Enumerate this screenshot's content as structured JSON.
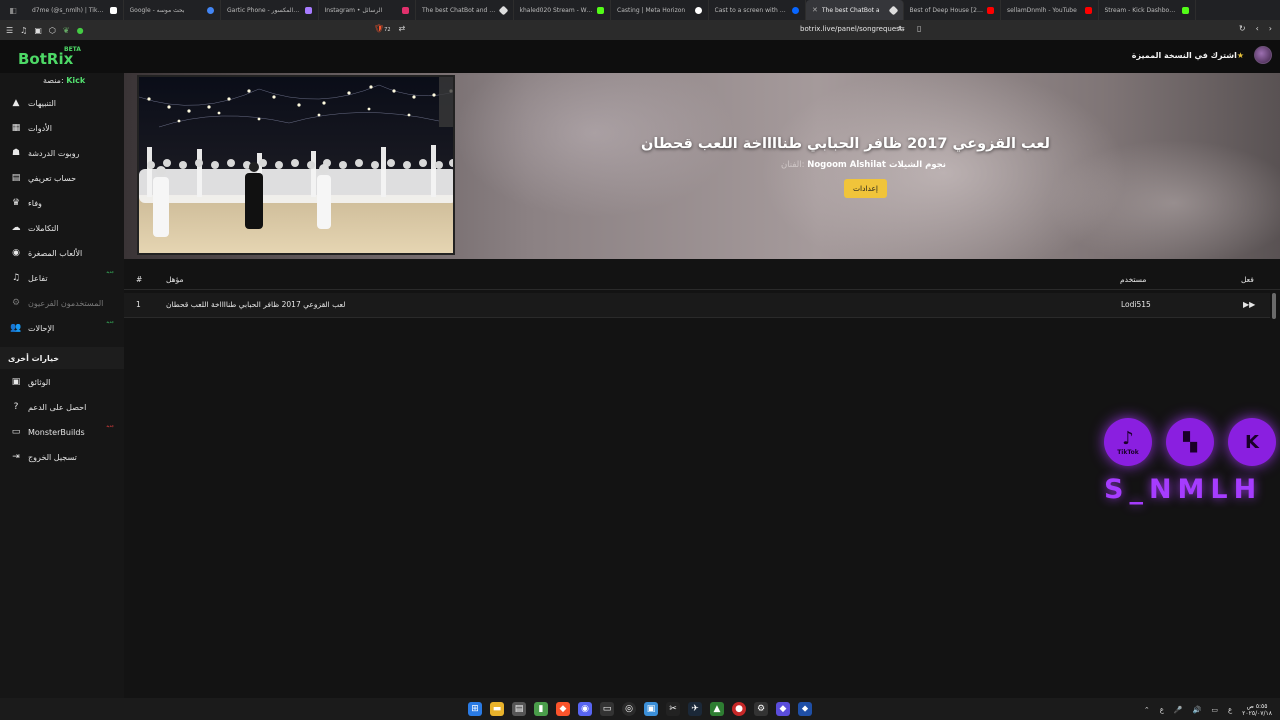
{
  "browser": {
    "tabs": [
      {
        "label": "d7me (@s_nmlh) | TikTok(5)",
        "color": "#ffffff"
      },
      {
        "label": "Google - بحث موسه",
        "color": "#4285f4"
      },
      {
        "label": "Gartic Phone - الطالب المكسور",
        "color": "#a77bff"
      },
      {
        "label": "Instagram • الرسائل",
        "color": "#e1306c"
      },
      {
        "label": "The best ChatBot and Wid",
        "color": "#ffffff"
      },
      {
        "label": "khaled020 Stream - Watch",
        "color": "#53fc18"
      },
      {
        "label": "Casting | Meta Horizon",
        "color": "#ffffff"
      },
      {
        "label": "Cast to a screen with Meta",
        "color": "#0866ff"
      },
      {
        "label": "The best ChatBot a",
        "color": "#ffffff",
        "active": true
      },
      {
        "label": "Best of Deep House [2025]",
        "color": "#ff0000"
      },
      {
        "label": "sellamDnmlh - YouTube",
        "color": "#ff0000"
      },
      {
        "label": "Stream - Kick Dashboard",
        "color": "#53fc18"
      }
    ],
    "url": "botrix.live/panel/songrequest",
    "shield_count": "72"
  },
  "app": {
    "logo": "BotRix",
    "logo_badge": "BETA",
    "premium_text": "اشترك في النسخة المميزة",
    "platform_label": "منصة:",
    "platform_value": "Kick"
  },
  "sidebar": {
    "items": [
      {
        "label": "التنبيهات",
        "icon": "warning-icon"
      },
      {
        "label": "الأدوات",
        "icon": "grid-icon"
      },
      {
        "label": "روبوت الدردشة",
        "icon": "robot-icon"
      },
      {
        "label": "حساب تعريفي",
        "icon": "id-card-icon"
      },
      {
        "label": "وفاء",
        "icon": "trophy-icon"
      },
      {
        "label": "التكاملات",
        "icon": "cloud-icon"
      },
      {
        "label": "الألعاب المصغرة",
        "icon": "gamepad-icon"
      },
      {
        "label": "تفاعل",
        "icon": "music-icon",
        "badge": "جديد"
      },
      {
        "label": "المستخدمون الفرعيون",
        "icon": "gear-icon",
        "disabled": true
      },
      {
        "label": "الإحالات",
        "icon": "users-icon",
        "badge": "جديد"
      }
    ],
    "section_title": "خيارات أخرى",
    "other_items": [
      {
        "label": "الوثائق",
        "icon": "book-icon"
      },
      {
        "label": "احصل على الدعم",
        "icon": "help-icon"
      },
      {
        "label": "MonsterBuilds",
        "icon": "laptop-icon",
        "badge": "جديد"
      },
      {
        "label": "تسجيل الخروج",
        "icon": "logout-icon"
      }
    ]
  },
  "now_playing": {
    "title": "لعب القزوعي 2017 ظافر الحبابي طنااااخة اللعب قحطان",
    "artist_label": "الفنان:",
    "artist": "Nogoom Alshilat نجوم الشيلات",
    "settings_button": "إعدادات"
  },
  "queue": {
    "headers": {
      "index": "#",
      "title": "مؤهل",
      "user": "مستخدم",
      "action": "فعل"
    },
    "rows": [
      {
        "index": "1",
        "title": "لعب القزوعي 2017 ظافر الحبابي طنااااخة اللعب قحطان",
        "user": "Lodi515"
      }
    ]
  },
  "overlay": {
    "handle": "S_NMLH",
    "networks": [
      {
        "name": "TikTok",
        "icon": "tiktok-icon"
      },
      {
        "name": "Twitch",
        "icon": "twitch-icon"
      },
      {
        "name": "Kick",
        "icon": "kick-icon"
      }
    ]
  },
  "taskbar": {
    "time": "٥:٥٥ ص",
    "date": "٢٠٢٥/٠٧/١٨"
  }
}
